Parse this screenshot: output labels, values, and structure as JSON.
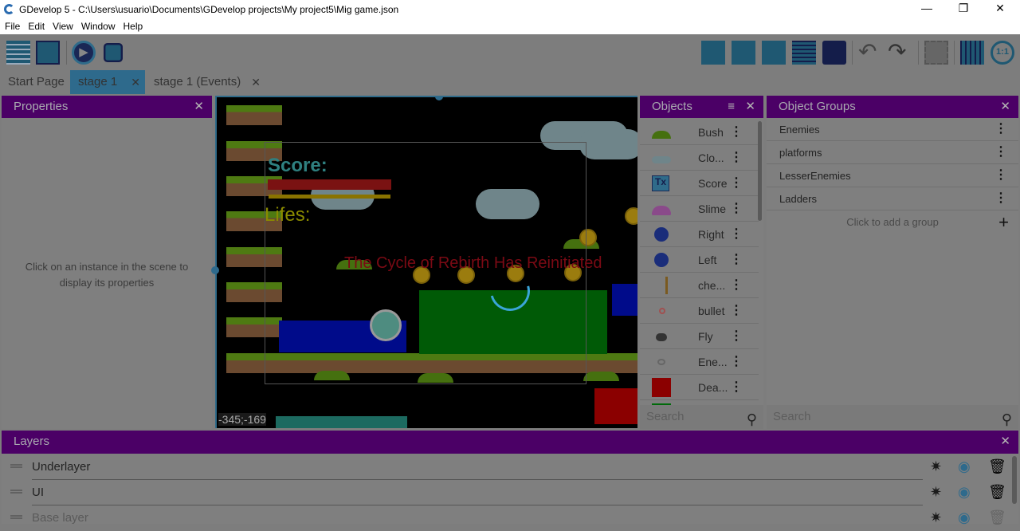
{
  "window": {
    "title": "GDevelop 5 - C:\\Users\\usuario\\Documents\\GDevelop projects\\My project5\\Mig game.json",
    "minimize": "—",
    "restore": "❐",
    "close": "✕"
  },
  "menu": [
    "File",
    "Edit",
    "View",
    "Window",
    "Help"
  ],
  "toolbar": {
    "left": [
      "project-manager-icon",
      "scene-properties-icon",
      "preview-icon",
      "debugger-icon"
    ],
    "right": [
      "objects-panel-icon",
      "object-groups-icon",
      "properties-panel-icon",
      "instances-list-icon",
      "layers-panel-icon",
      "undo-icon",
      "redo-icon",
      "delete-selection-icon",
      "grid-icon",
      "zoom-reset-icon"
    ]
  },
  "tabs": [
    {
      "label": "Start Page"
    },
    {
      "label": "stage 1",
      "active": true,
      "close": "✕"
    },
    {
      "label": "stage 1 (Events)",
      "close": "✕"
    }
  ],
  "properties": {
    "title": "Properties",
    "close": "✕",
    "message": "Click on an instance in the scene to display its properties"
  },
  "scene": {
    "score_label": "Score:",
    "lifes_label": "Lifes:",
    "banner": "The Cycle of Rebirth Has Reinitiated",
    "coords": "-345;-169",
    "loading": true
  },
  "objects": {
    "title": "Objects",
    "close": "✕",
    "items": [
      {
        "name": "Bush"
      },
      {
        "name": "Clo..."
      },
      {
        "name": "Score"
      },
      {
        "name": "Slime"
      },
      {
        "name": "Right"
      },
      {
        "name": "Left"
      },
      {
        "name": "che..."
      },
      {
        "name": "bullet"
      },
      {
        "name": "Fly"
      },
      {
        "name": "Ene..."
      },
      {
        "name": "Dea..."
      }
    ],
    "search_placeholder": "Search"
  },
  "groups": {
    "title": "Object Groups",
    "close": "✕",
    "items": [
      "Enemies",
      "platforms",
      "LesserEnemies",
      "Ladders"
    ],
    "add_label": "Click to add a group",
    "add_icon": "+",
    "search_placeholder": "Search"
  },
  "layers": {
    "title": "Layers",
    "close": "✕",
    "items": [
      {
        "name": "Underlayer"
      },
      {
        "name": "UI"
      },
      {
        "name": "Base layer"
      }
    ]
  },
  "colors": {
    "header": "#4b0066",
    "accent": "#2e6a8c"
  }
}
